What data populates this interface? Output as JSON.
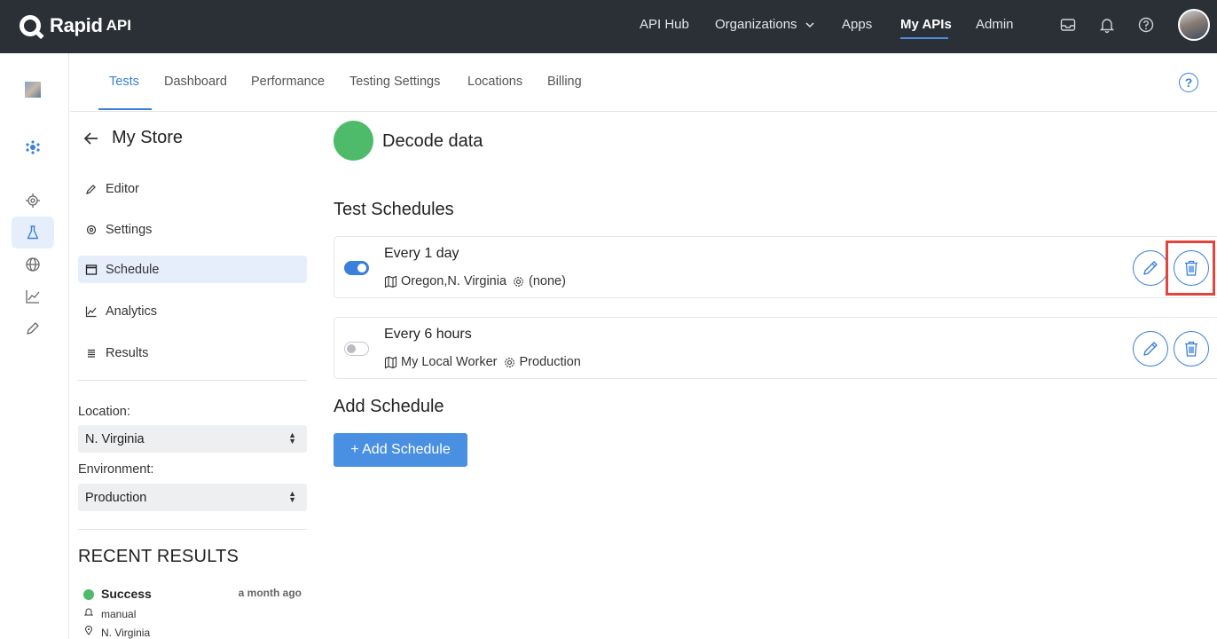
{
  "brand": {
    "name": "Rapid",
    "suffix": "API"
  },
  "topnav": {
    "items": [
      "API Hub",
      "Organizations",
      "Apps",
      "My APIs",
      "Admin"
    ],
    "active": "My APIs",
    "icons": [
      "inbox-icon",
      "bell-icon",
      "help-icon",
      "user-avatar"
    ]
  },
  "tabs": [
    "Tests",
    "Dashboard",
    "Performance",
    "Testing Settings",
    "Locations",
    "Billing"
  ],
  "active_tab": "Tests",
  "sidebar": {
    "back_title": "My Store",
    "menu": [
      "Editor",
      "Settings",
      "Schedule",
      "Analytics",
      "Results"
    ],
    "active_menu": "Schedule",
    "location_label": "Location:",
    "location_value": "N. Virginia",
    "environment_label": "Environment:",
    "environment_value": "Production",
    "recent_title": "RECENT RESULTS",
    "recent": [
      {
        "status": "Success",
        "time": "a month ago",
        "trigger": "manual",
        "location": "N. Virginia"
      }
    ]
  },
  "main": {
    "test_name": "Decode data",
    "schedules_title": "Test Schedules",
    "schedules": [
      {
        "title": "Every 1 day",
        "locations": "Oregon,N. Virginia",
        "environment": "(none)",
        "enabled": true
      },
      {
        "title": "Every 6 hours",
        "locations": "My Local Worker",
        "environment": "Production",
        "enabled": false
      }
    ],
    "add_title": "Add Schedule",
    "add_button": "+ Add Schedule"
  },
  "colors": {
    "accent": "#3a7fdc",
    "success": "#4dbb6a",
    "topbar": "#2b3036",
    "highlight": "#e2453c"
  }
}
